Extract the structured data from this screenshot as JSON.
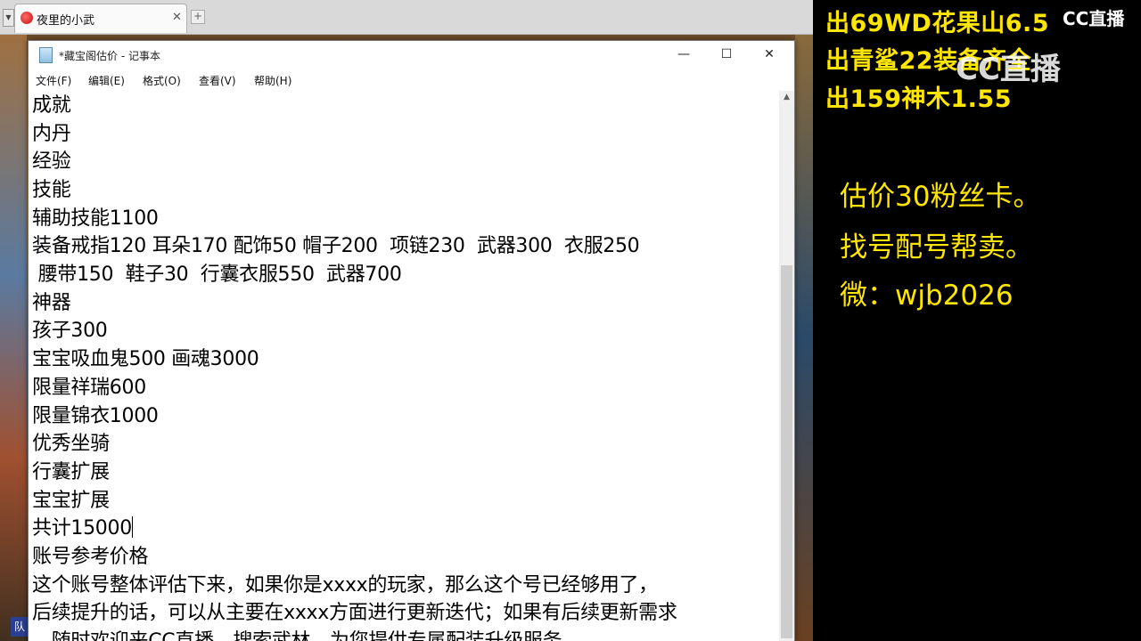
{
  "browser": {
    "tab_title": "夜里的小武",
    "tab_close": "✕",
    "new_tab": "+"
  },
  "notepad": {
    "title": "*藏宝阁估价 - 记事本",
    "window_buttons": {
      "minimize": "—",
      "maximize": "☐",
      "close": "✕"
    },
    "menu": [
      "文件(F)",
      "编辑(E)",
      "格式(O)",
      "查看(V)",
      "帮助(H)"
    ],
    "lines": [
      "成就",
      "内丹",
      "经验",
      "技能",
      "辅助技能1100",
      "装备戒指120 耳朵170 配饰50 帽子200  项链230  武器300  衣服250",
      " 腰带150  鞋子30  行囊衣服550  武器700",
      "神器",
      "孩子300",
      "宝宝吸血鬼500 画魂3000",
      "限量祥瑞600",
      "限量锦衣1000",
      "优秀坐骑",
      "行囊扩展",
      "宝宝扩展",
      "共计15000",
      "账号参考价格",
      "这个账号整体评估下来，如果你是xxxx的玩家，那么这个号已经够用了，",
      "后续提升的话，可以从主要在xxxx方面进行更新迭代；如果有后续更新需求",
      "，随时欢迎来CC直播，搜索武林，为您提供专属配装升级服务"
    ]
  },
  "overlay": {
    "promos": [
      "出69WD花果山6.5",
      "出青鲨22装备齐全",
      "出159神木1.55"
    ],
    "logo_small": "CC直播",
    "logo_big": "CC直播",
    "info": [
      "估价30粉丝卡。",
      "找号配号帮卖。",
      "微：wjb2026"
    ]
  },
  "game": {
    "chip": "队"
  }
}
